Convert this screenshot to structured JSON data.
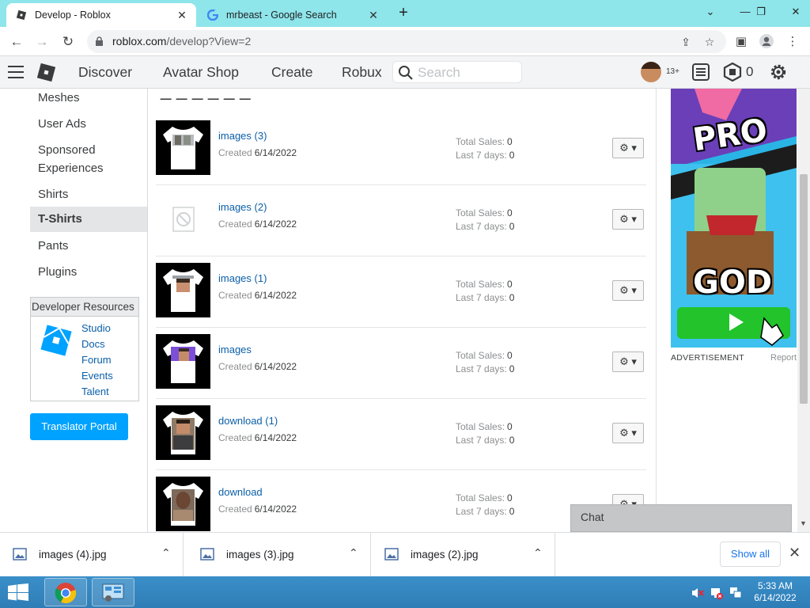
{
  "browser": {
    "tabs": [
      {
        "title": "Develop - Roblox",
        "active": true
      },
      {
        "title": "mrbeast - Google Search",
        "active": false
      }
    ],
    "url_host": "roblox.com",
    "url_path": "/develop?View=2",
    "window_controls": [
      "chevron-down-icon",
      "minimize-icon",
      "restore-icon",
      "close-icon"
    ]
  },
  "header": {
    "nav": [
      "Discover",
      "Avatar Shop",
      "Create",
      "Robux"
    ],
    "search_placeholder": "Search",
    "age_badge": "13+",
    "robux_balance": "0"
  },
  "sidebar": {
    "items": [
      "Meshes",
      "User Ads",
      "Sponsored",
      "Experiences",
      "Shirts",
      "T-Shirts",
      "Pants",
      "Plugins"
    ],
    "active_item": "T-Shirts",
    "dev_resources": {
      "title": "Developer Resources",
      "links": [
        "Studio",
        "Docs",
        "Forum",
        "Events",
        "Talent"
      ]
    },
    "translator_button": "Translator Portal"
  },
  "assets": {
    "created_label": "Created",
    "total_sales_label": "Total Sales:",
    "last7_label": "Last 7 days:",
    "rows": [
      {
        "name": "images (3)",
        "created": "6/14/2022",
        "total_sales": "0",
        "last7": "0"
      },
      {
        "name": "images (2)",
        "created": "6/14/2022",
        "total_sales": "0",
        "last7": "0"
      },
      {
        "name": "images (1)",
        "created": "6/14/2022",
        "total_sales": "0",
        "last7": "0"
      },
      {
        "name": "images",
        "created": "6/14/2022",
        "total_sales": "0",
        "last7": "0"
      },
      {
        "name": "download (1)",
        "created": "6/14/2022",
        "total_sales": "0",
        "last7": "0"
      },
      {
        "name": "download",
        "created": "6/14/2022",
        "total_sales": "0",
        "last7": "0"
      }
    ]
  },
  "ad": {
    "text_top": "PRO",
    "text_bottom": "GOD",
    "label": "ADVERTISEMENT",
    "report": "Report"
  },
  "chat": {
    "label": "Chat"
  },
  "downloads": {
    "items": [
      "images (4).jpg",
      "images (3).jpg",
      "images (2).jpg"
    ],
    "show_all": "Show all"
  },
  "taskbar": {
    "time": "5:33 AM",
    "date": "6/14/2022"
  },
  "colors": {
    "tabstrip": "#8ee5ea",
    "link": "#0b5fa8",
    "primary_button": "#00a2ff",
    "taskbar": "#2f7db6"
  }
}
